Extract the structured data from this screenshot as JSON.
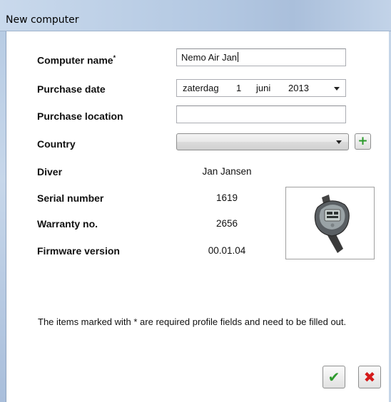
{
  "window": {
    "title": "New computer"
  },
  "form": {
    "computer_name": {
      "label": "Computer name",
      "required_mark": "*",
      "value": "Nemo Air Jan"
    },
    "purchase_date": {
      "label": "Purchase date",
      "weekday": "zaterdag",
      "day": "1",
      "month": "juni",
      "year": "2013"
    },
    "purchase_location": {
      "label": "Purchase location",
      "value": ""
    },
    "country": {
      "label": "Country",
      "selected": ""
    },
    "diver": {
      "label": "Diver",
      "value": "Jan Jansen"
    },
    "serial_number": {
      "label": "Serial number",
      "value": "1619"
    },
    "warranty_no": {
      "label": "Warranty no.",
      "value": "2656"
    },
    "firmware_version": {
      "label": "Firmware version",
      "value": "00.01.04"
    }
  },
  "device_image": {
    "description": "dive computer wristwatch"
  },
  "footer": {
    "note": "The items marked with * are required profile fields and need to be filled out."
  },
  "buttons": {
    "ok_icon": "check-icon",
    "cancel_icon": "x-icon",
    "add_country_icon": "plus-icon"
  },
  "colors": {
    "ok": "#2e9b2e",
    "cancel": "#d41a1a",
    "titlebar": "#b3c8e2"
  }
}
